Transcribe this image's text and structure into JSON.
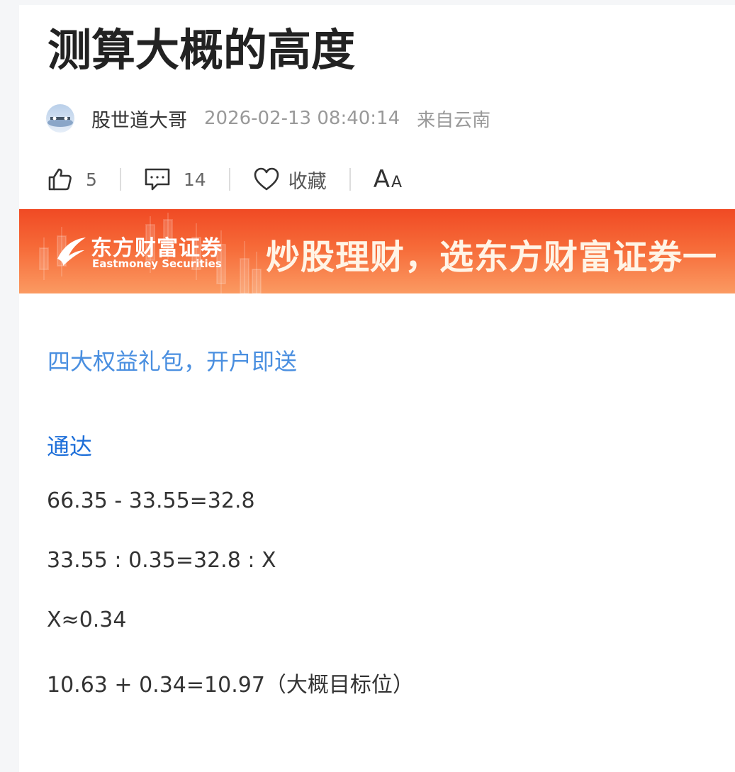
{
  "article": {
    "title": "测算大概的高度",
    "author": "股世道大哥",
    "datetime": "2026-02-13 08:40:14",
    "location": "来自云南"
  },
  "actions": {
    "like_count": "5",
    "comment_count": "14",
    "favorite_label": "收藏",
    "font_large": "A",
    "font_small": "A"
  },
  "banner": {
    "logo_zh": "东方财富证券",
    "logo_en": "Eastmoney Securities",
    "slogan": "炒股理财，选东方财富证券一"
  },
  "content": {
    "ad_link": "四大权益礼包，开户即送",
    "tag_link": "通达",
    "lines": [
      "66.35 - 33.55=32.8",
      "33.55 : 0.35=32.8 : X",
      "X≈0.34",
      "10.63 + 0.34=10.97（大概目标位）"
    ]
  },
  "colors": {
    "link": "#4a8fe0",
    "tag_link": "#1e6fd9",
    "banner_top": "#f04a24",
    "banner_bottom": "#fb9a62"
  }
}
